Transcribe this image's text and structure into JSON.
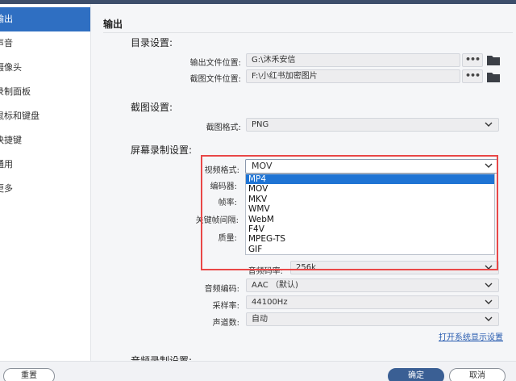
{
  "sidebar": {
    "items": [
      {
        "label": "输出",
        "active": true
      },
      {
        "label": "声音"
      },
      {
        "label": "摄像头"
      },
      {
        "label": "录制面板"
      },
      {
        "label": "鼠标和键盘"
      },
      {
        "label": "快捷键"
      },
      {
        "label": "通用"
      },
      {
        "label": "更多"
      }
    ]
  },
  "main": {
    "title": "输出",
    "directory_section": {
      "heading": "目录设置:",
      "output_label": "输出文件位置:",
      "output_value": "G:\\沐禾安信",
      "screenshot_label": "截图文件位置:",
      "screenshot_value": "F:\\小红书加密图片",
      "browse_label": "•••"
    },
    "screenshot_section": {
      "heading": "截图设置:",
      "format_label": "截图格式:",
      "format_value": "PNG"
    },
    "recording_section": {
      "heading": "屏幕录制设置:",
      "video_format_label": "视频格式:",
      "video_format_value": "MOV",
      "video_format_options": [
        "MP4",
        "MOV",
        "MKV",
        "WMV",
        "WebM",
        "F4V",
        "MPEG-TS",
        "GIF"
      ],
      "highlighted_option": "MP4",
      "encoder_label": "编码器:",
      "fps_label": "帧率:",
      "keyframe_label": "关键帧间隔:",
      "quality_label": "质量:",
      "audio_bitrate_label": "音频码率:",
      "audio_bitrate_value": "256k",
      "audio_codec_label": "音频编码:",
      "audio_codec_value": "AAC （默认)",
      "sample_rate_label": "采样率:",
      "sample_rate_value": "44100Hz",
      "channels_label": "声道数:",
      "channels_value": "自动",
      "system_display_link": "打开系统显示设置"
    },
    "audio_section": {
      "heading": "音频录制设置:"
    }
  },
  "footer": {
    "reset_label": "重置",
    "ok_label": "确定",
    "cancel_label": "取消"
  },
  "colors": {
    "accent": "#2f6fc2",
    "highlight": "#1f74d4",
    "annotation_box": "#e94747",
    "topbar": "#3d4e6b"
  }
}
